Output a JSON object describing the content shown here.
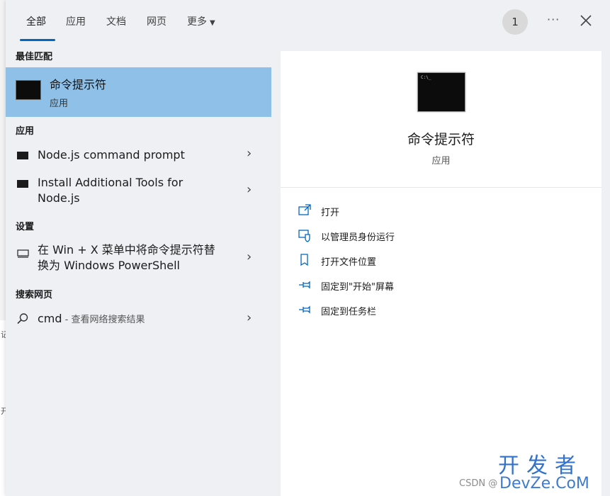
{
  "tabs": [
    {
      "label": "全部"
    },
    {
      "label": "应用"
    },
    {
      "label": "文档"
    },
    {
      "label": "网页"
    },
    {
      "label": "更多"
    }
  ],
  "header": {
    "user_badge": "1",
    "more_dots": "···"
  },
  "sections": {
    "best_match": "最佳匹配",
    "apps": "应用",
    "settings": "设置",
    "web": "搜索网页"
  },
  "best_match": {
    "title": "命令提示符",
    "subtitle": "应用"
  },
  "apps": [
    {
      "label": "Node.js command prompt"
    },
    {
      "label_line1": "Install Additional Tools for",
      "label_line2": "Node.js"
    }
  ],
  "settings": [
    {
      "label_line1": "在 Win + X 菜单中将命令提示符替",
      "label_line2": "换为 Windows PowerShell"
    }
  ],
  "web": [
    {
      "query": "cmd",
      "suffix": " - 查看网络搜索结果"
    }
  ],
  "detail": {
    "icon_text": "C:\\_",
    "title": "命令提示符",
    "subtitle": "应用",
    "actions": [
      {
        "label": "打开",
        "icon": "open-icon"
      },
      {
        "label": "以管理员身份运行",
        "icon": "shield-run-icon"
      },
      {
        "label": "打开文件位置",
        "icon": "file-location-icon"
      },
      {
        "label": "固定到\"开始\"屏幕",
        "icon": "pin-icon"
      },
      {
        "label": "固定到任务栏",
        "icon": "pin-icon"
      }
    ]
  },
  "background": {
    "glyph_1": "记",
    "glyph_2": "开"
  },
  "watermark": {
    "big": "开发者",
    "small": "DevZe.CoM",
    "csdn": "CSDN @"
  },
  "colors": {
    "accent": "#0067c0",
    "selected_row": "#8fc1e8",
    "watermark": "#1d63c6"
  }
}
